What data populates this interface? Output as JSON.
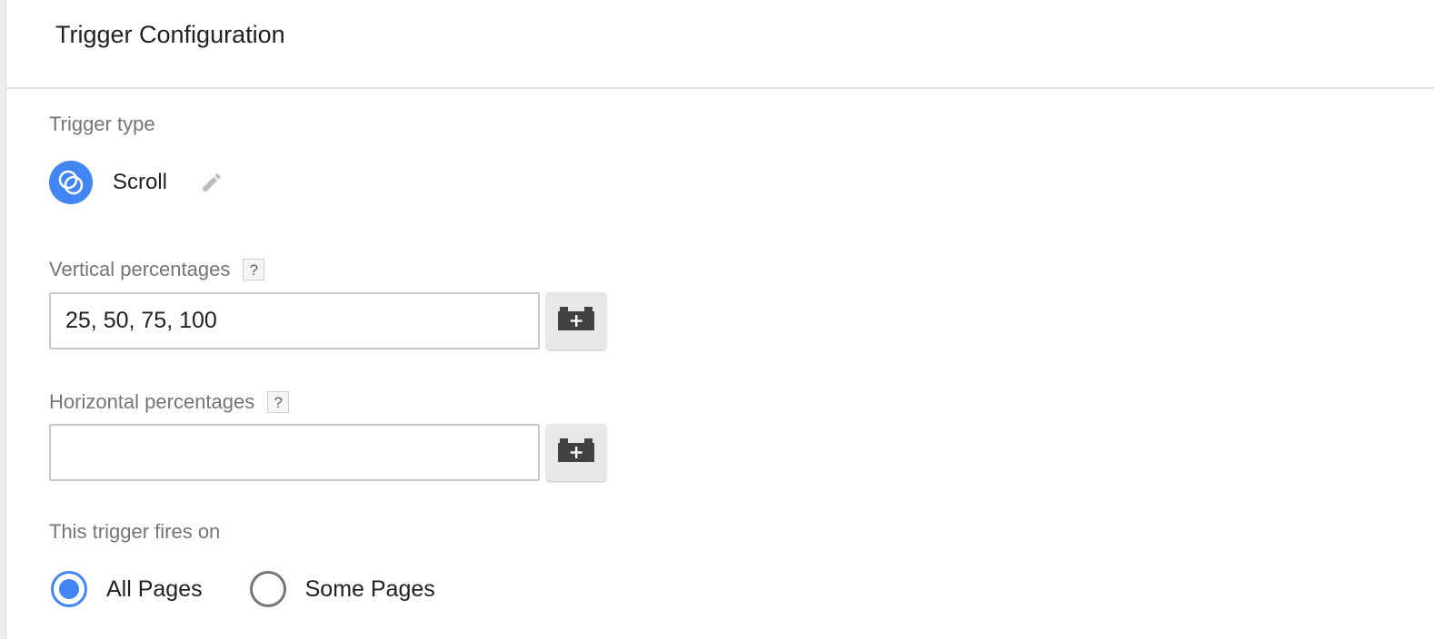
{
  "header": {
    "title": "Trigger Configuration"
  },
  "trigger_type": {
    "label": "Trigger type",
    "name": "Scroll",
    "icon": "scroll-trigger-icon",
    "edit_icon": "pencil-icon",
    "accent_color": "#4285f4"
  },
  "vertical": {
    "label": "Vertical percentages",
    "help": "?",
    "value": "25, 50, 75, 100",
    "variable_icon": "variable-brick-icon"
  },
  "horizontal": {
    "label": "Horizontal percentages",
    "help": "?",
    "value": "",
    "variable_icon": "variable-brick-icon"
  },
  "fires_on": {
    "label": "This trigger fires on",
    "options": [
      {
        "label": "All Pages",
        "selected": true
      },
      {
        "label": "Some Pages",
        "selected": false
      }
    ]
  }
}
